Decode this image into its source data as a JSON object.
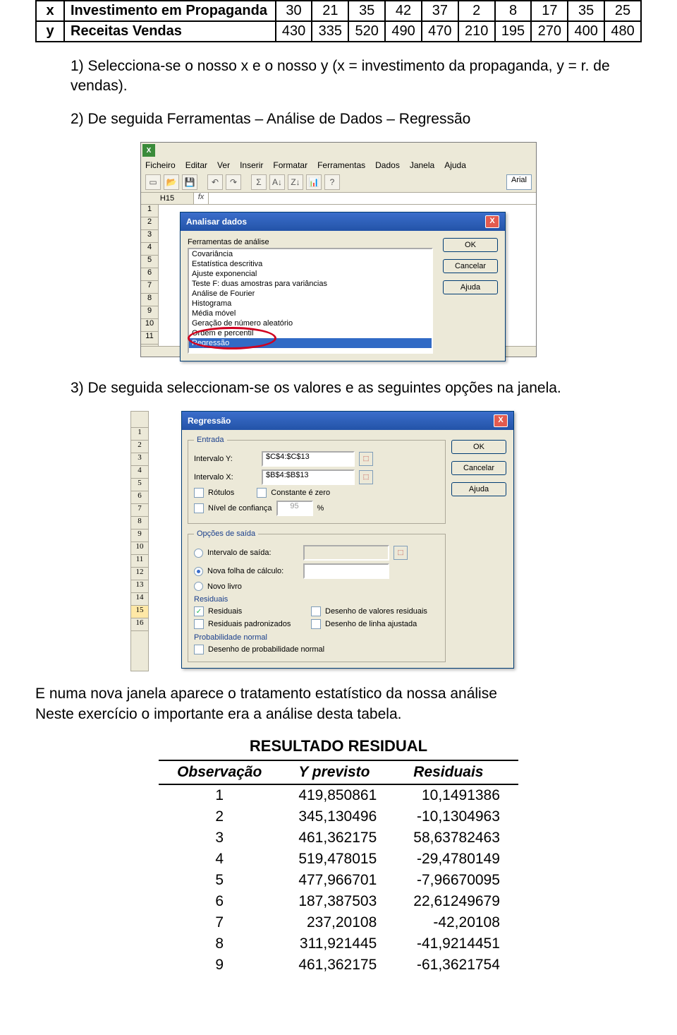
{
  "data_table": {
    "rows": [
      {
        "key": "x",
        "label": "Investimento em Propaganda",
        "values": [
          "30",
          "21",
          "35",
          "42",
          "37",
          "2",
          "8",
          "17",
          "35",
          "25"
        ]
      },
      {
        "key": "y",
        "label": "Receitas  Vendas",
        "values": [
          "430",
          "335",
          "520",
          "490",
          "470",
          "210",
          "195",
          "270",
          "400",
          "480"
        ]
      }
    ]
  },
  "steps": {
    "s1": "Selecciona-se o nosso x e o nosso y (x = investimento da propaganda, y = r. de vendas).",
    "s2": "De seguida Ferramentas – Análise de Dados – Regressão",
    "s3": "De seguida seleccionam-se os valores e as seguintes opções na janela."
  },
  "excel": {
    "menus": [
      "Ficheiro",
      "Editar",
      "Ver",
      "Inserir",
      "Formatar",
      "Ferramentas",
      "Dados",
      "Janela",
      "Ajuda"
    ],
    "font": "Arial",
    "namebox": "H15",
    "rows": [
      "1",
      "2",
      "3",
      "4",
      "5",
      "6",
      "7",
      "8",
      "9",
      "10",
      "11"
    ]
  },
  "analisar": {
    "title": "Analisar dados",
    "label": "Ferramentas de análise",
    "items": [
      "Covariância",
      "Estatística descritiva",
      "Ajuste exponencial",
      "Teste F: duas amostras para variâncias",
      "Análise de Fourier",
      "Histograma",
      "Média móvel",
      "Geração de número aleatório",
      "Ordem e percentil",
      "Regressão"
    ],
    "ok": "OK",
    "cancel": "Cancelar",
    "help": "Ajuda"
  },
  "regress": {
    "title": "Regressão",
    "entrada": "Entrada",
    "iy": "Intervalo Y:",
    "iy_val": "$C$4:$C$13",
    "ix": "Intervalo X:",
    "ix_val": "$B$4:$B$13",
    "rotulos": "Rótulos",
    "const0": "Constante é zero",
    "conf": "Nível de confiança",
    "confval": "95",
    "pct": "%",
    "saida": "Opções de saída",
    "o_interv": "Intervalo de saída:",
    "o_nova": "Nova folha de cálculo:",
    "o_novo": "Novo livro",
    "residuais": "Residuais",
    "r1": "Residuais",
    "r2": "Desenho de valores residuais",
    "r3": "Residuais padronizados",
    "r4": "Desenho de linha ajustada",
    "probn": "Probabilidade normal",
    "dpn": "Desenho de probabilidade normal",
    "ok": "OK",
    "cancel": "Cancelar",
    "help": "Ajuda",
    "rows": [
      "1",
      "2",
      "3",
      "4",
      "5",
      "6",
      "7",
      "8",
      "9",
      "10",
      "11",
      "12",
      "13",
      "14",
      "15",
      "16"
    ]
  },
  "after_text": "E numa nova janela aparece o tratamento estatístico da nossa análise\nNeste exercício o importante era a análise desta tabela.",
  "result": {
    "title": "RESULTADO RESIDUAL",
    "h1": "Observação",
    "h2": "Y previsto",
    "h3": "Residuais",
    "rows": [
      {
        "o": "1",
        "y": "419,850861",
        "r": "10,1491386"
      },
      {
        "o": "2",
        "y": "345,130496",
        "r": "-10,1304963"
      },
      {
        "o": "3",
        "y": "461,362175",
        "r": "58,63782463"
      },
      {
        "o": "4",
        "y": "519,478015",
        "r": "-29,4780149"
      },
      {
        "o": "5",
        "y": "477,966701",
        "r": "-7,96670095"
      },
      {
        "o": "6",
        "y": "187,387503",
        "r": "22,61249679"
      },
      {
        "o": "7",
        "y": "237,20108",
        "r": "-42,20108"
      },
      {
        "o": "8",
        "y": "311,921445",
        "r": "-41,9214451"
      },
      {
        "o": "9",
        "y": "461,362175",
        "r": "-61,3621754"
      }
    ]
  },
  "chart_data": {
    "type": "table",
    "title": "Investimento em Propaganda vs Receitas Vendas",
    "series": [
      {
        "name": "x — Investimento em Propaganda",
        "values": [
          30,
          21,
          35,
          42,
          37,
          2,
          8,
          17,
          35,
          25
        ]
      },
      {
        "name": "y — Receitas Vendas",
        "values": [
          430,
          335,
          520,
          490,
          470,
          210,
          195,
          270,
          400,
          480
        ]
      }
    ],
    "residual_table": {
      "columns": [
        "Observação",
        "Y previsto",
        "Residuais"
      ],
      "rows": [
        [
          1,
          419.850861,
          10.1491386
        ],
        [
          2,
          345.130496,
          -10.1304963
        ],
        [
          3,
          461.362175,
          58.63782463
        ],
        [
          4,
          519.478015,
          -29.4780149
        ],
        [
          5,
          477.966701,
          -7.96670095
        ],
        [
          6,
          187.387503,
          22.61249679
        ],
        [
          7,
          237.20108,
          -42.20108
        ],
        [
          8,
          311.921445,
          -41.9214451
        ],
        [
          9,
          461.362175,
          -61.3621754
        ]
      ]
    }
  }
}
